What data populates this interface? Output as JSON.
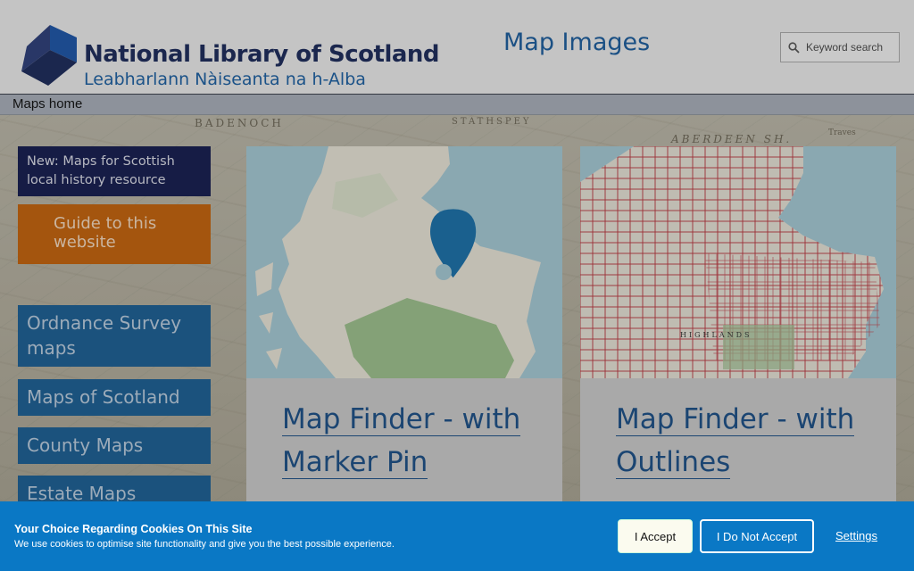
{
  "header": {
    "logo_name": "National Library of Scotland",
    "logo_gaelic": "Leabharlann Nàiseanta na h-Alba",
    "site_title": "Map Images",
    "search_placeholder": "Keyword search"
  },
  "nav": {
    "home_label": "Maps home"
  },
  "background_places": [
    "BADENOCH",
    "STATHSPEY",
    "ABERDEEN SH.",
    "Traves"
  ],
  "sidebar": {
    "news": "New: Maps for Scottish local history resource",
    "guide": "Guide to this website",
    "items": [
      {
        "label": "Ordnance Survey maps"
      },
      {
        "label": "Maps of Scotland"
      },
      {
        "label": "County Maps"
      },
      {
        "label": "Estate Maps"
      }
    ]
  },
  "cards": [
    {
      "title": "Map Finder - with Marker Pin",
      "image_icon": "map-marker-pin-icon"
    },
    {
      "title": "Map Finder - with Outlines",
      "image_icon": "map-outlines-grid"
    }
  ],
  "map_labels": [
    "HIGHLANDS"
  ],
  "cookie": {
    "title": "Your Choice Regarding Cookies On This Site",
    "text": "We use cookies to optimise site functionality and give you the best possible experience.",
    "accept": "I Accept",
    "decline": "I Do Not Accept",
    "settings": "Settings"
  },
  "colors": {
    "brand_navy": "#1c2a5a",
    "brand_blue": "#1b5c9c",
    "guide_orange": "#c2620c",
    "sidebar_blue": "#1b5e93",
    "cookie_blue": "#0a78c5"
  }
}
